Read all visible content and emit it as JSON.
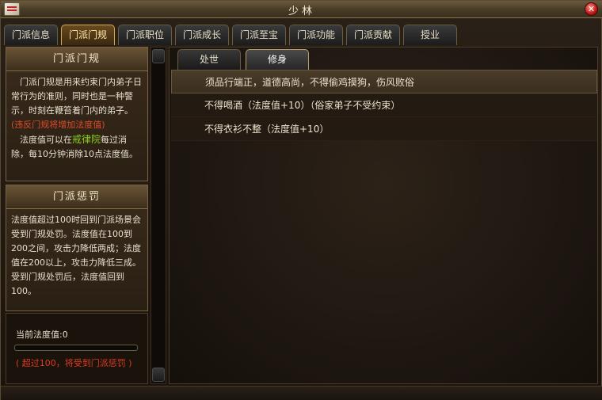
{
  "window": {
    "title": "少林"
  },
  "tabs": [
    {
      "label": "门派信息"
    },
    {
      "label": "门派门规",
      "active": true
    },
    {
      "label": "门派职位"
    },
    {
      "label": "门派成长"
    },
    {
      "label": "门派至宝"
    },
    {
      "label": "门派功能"
    },
    {
      "label": "门派贡献"
    },
    {
      "label": "授业"
    }
  ],
  "rules_panel": {
    "title": "门派门规",
    "intro": "门派门规是用来约束门内弟子日常行为的准则，同时也是一种警示，时刻在鞭笞着门内的弟子。",
    "warning": "(违反门规将增加法度值)",
    "reduce_prefix": "法度值可以在",
    "reduce_place": "戒律院",
    "reduce_suffix": "每过消除，每10分钟消除10点法度值。"
  },
  "penalty_panel": {
    "title": "门派惩罚",
    "text": "法度值超过100时回到门派场景会受到门规处罚。法度值在100到200之间，攻击力降低两成；法度值在200以上，攻击力降低三成。受到门规处罚后，法度值回到100。"
  },
  "status": {
    "label": "当前法度值:",
    "value": "0",
    "progress": 0,
    "warning": "( 超过100，将受到门派惩罚 )"
  },
  "subtabs": [
    {
      "label": "处世"
    },
    {
      "label": "修身",
      "active": true
    }
  ],
  "rules": [
    "须品行端正，道德高尚，不得偷鸡摸狗，伤风败俗",
    "不得喝酒（法度值+10）（俗家弟子不受约束）",
    "不得衣衫不整（法度值+10）"
  ],
  "colors": {
    "accent_gold": "#d9a84a",
    "warning_red": "#e04a2a",
    "highlight_green": "#8ad21a"
  }
}
